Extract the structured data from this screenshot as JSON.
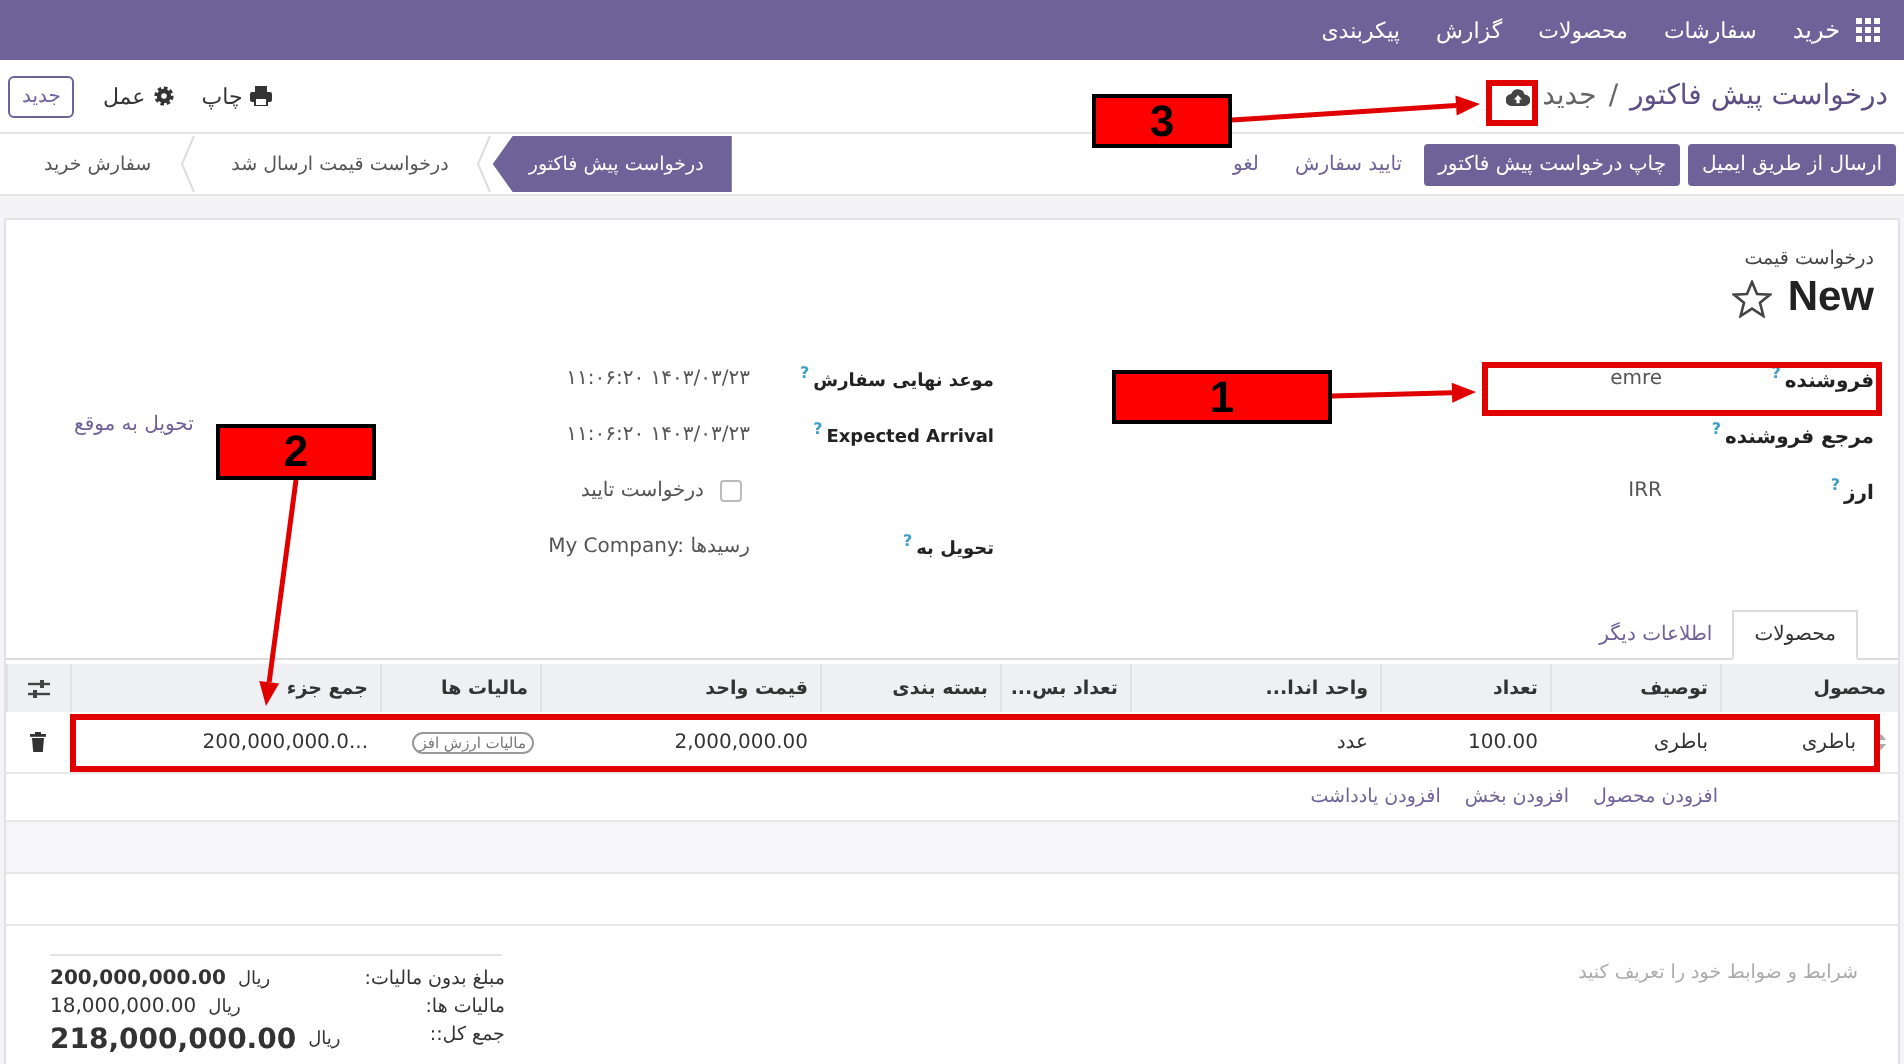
{
  "top_nav": {
    "app_name": "خرید",
    "menu": [
      "سفارشات",
      "محصولات",
      "گزارش",
      "پیکربندی"
    ]
  },
  "control_panel": {
    "breadcrumb": [
      "درخواست پیش فاکتور",
      "جدید"
    ],
    "separator": "/",
    "new_button": "جدید",
    "actions": [
      {
        "label": "چاپ",
        "kind": "print"
      },
      {
        "label": "عمل",
        "kind": "gear"
      }
    ]
  },
  "status_buttons": [
    {
      "label": "ارسال از طریق ایمیل",
      "primary": true
    },
    {
      "label": "چاپ درخواست پیش فاکتور",
      "primary": true
    },
    {
      "label": "تایید سفارش",
      "primary": false
    },
    {
      "label": "لغو",
      "primary": false
    }
  ],
  "stages": [
    {
      "label": "درخواست پیش فاکتور",
      "selected": true
    },
    {
      "label": "درخواست قیمت ارسال شد",
      "selected": false
    },
    {
      "label": "سفارش خرید",
      "selected": false
    }
  ],
  "form": {
    "subtitle": "درخواست قیمت",
    "title": "New",
    "favorite": false,
    "fields_right": [
      {
        "label": "فروشنده",
        "help": "?",
        "value": "emre"
      },
      {
        "label": "مرجع فروشنده",
        "help": "?"
      },
      {
        "label": "ارز",
        "help": "?",
        "value": "IRR"
      }
    ],
    "fields_left": [
      {
        "kind": "text",
        "label": "موعد نهایی سفارش",
        "help": "?",
        "value": "۱۱:۰۶:۲۰ ۱۴۰۳/۰۳/۲۳"
      },
      {
        "kind": "text",
        "label": "Expected Arrival",
        "help": "?",
        "value": "۱۱:۰۶:۲۰ ۱۴۰۳/۰۳/۲۳"
      },
      {
        "kind": "checkbox",
        "text": "درخواست تایید",
        "checked": false
      },
      {
        "kind": "text",
        "label": "تحویل به",
        "help": "?",
        "value": "My Company: رسیدها"
      }
    ],
    "side_link": "تحویل به موقع"
  },
  "tabs": [
    {
      "label": "محصولات",
      "selected": true
    },
    {
      "label": "اطلاعات دیگر",
      "selected": false
    }
  ],
  "table": {
    "columns": [
      "محصول",
      "توصیف",
      "تعداد",
      "واحد اندا...",
      "تعداد بس...",
      "بسته بندی",
      "قیمت واحد",
      "مالیات ها",
      "جمع جزء"
    ],
    "rows": [
      {
        "cells": [
          "باطری",
          "باطری",
          "100.00",
          "عدد",
          "",
          "",
          "2,000,000.00"
        ],
        "taxes": [
          "مالیات ارزش افز"
        ],
        "subtotal": "200,000,000.0..."
      }
    ],
    "add_links": [
      "افزودن محصول",
      "افزودن بخش",
      "افزودن یادداشت"
    ]
  },
  "terms_placeholder": "شرایط و ضوابط خود را تعریف کنید",
  "totals": [
    {
      "kind": "untaxed",
      "label": "مبلغ بدون مالیات:",
      "currency": "ریال",
      "amount": "200,000,000.00"
    },
    {
      "kind": "tax",
      "label": "مالیات ها:",
      "currency": "ریال",
      "amount": "18,000,000.00"
    },
    {
      "kind": "total",
      "label": "جمع کل::",
      "currency": "ریال",
      "amount": "218,000,000.00"
    }
  ],
  "callouts": [
    {
      "number": "1"
    },
    {
      "number": "2"
    },
    {
      "number": "3"
    }
  ]
}
